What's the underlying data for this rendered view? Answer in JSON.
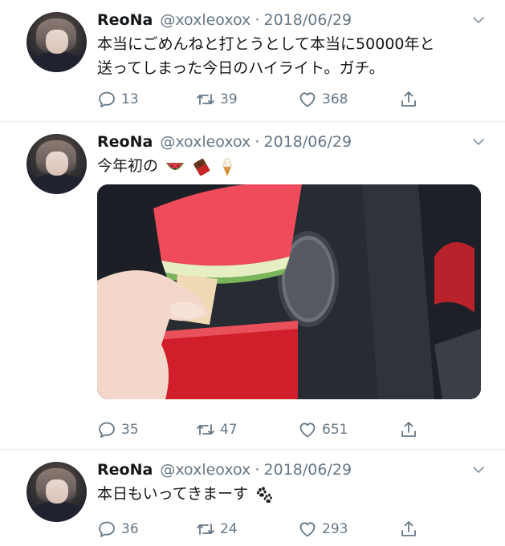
{
  "tweets": [
    {
      "name": "ReoNa",
      "handle": "@xoxleoxox",
      "separator": "·",
      "date": "2018/06/29",
      "text_line1": "本当にごめんねと打とうとして本当に50000年と",
      "text_line2": "送ってしまった今日のハイライト。ガチ。",
      "replies": "13",
      "retweets": "39",
      "likes": "368"
    },
    {
      "name": "ReoNa",
      "handle": "@xoxleoxox",
      "separator": "·",
      "date": "2018/06/29",
      "text": "今年初の",
      "emojis": [
        "watermelon",
        "chocolate-bar",
        "soft-ice-cream"
      ],
      "photo": "watermelon-popsicle-in-car",
      "replies": "35",
      "retweets": "47",
      "likes": "651"
    },
    {
      "name": "ReoNa",
      "handle": "@xoxleoxox",
      "separator": "·",
      "date": "2018/06/29",
      "text": "本日もいってきまーす",
      "emojis": [
        "paw-prints"
      ],
      "replies": "36",
      "retweets": "24",
      "likes": "293"
    }
  ],
  "colors": {
    "secondary_text": "#657786",
    "primary_text": "#14171a",
    "divider": "#e6ecf0"
  }
}
